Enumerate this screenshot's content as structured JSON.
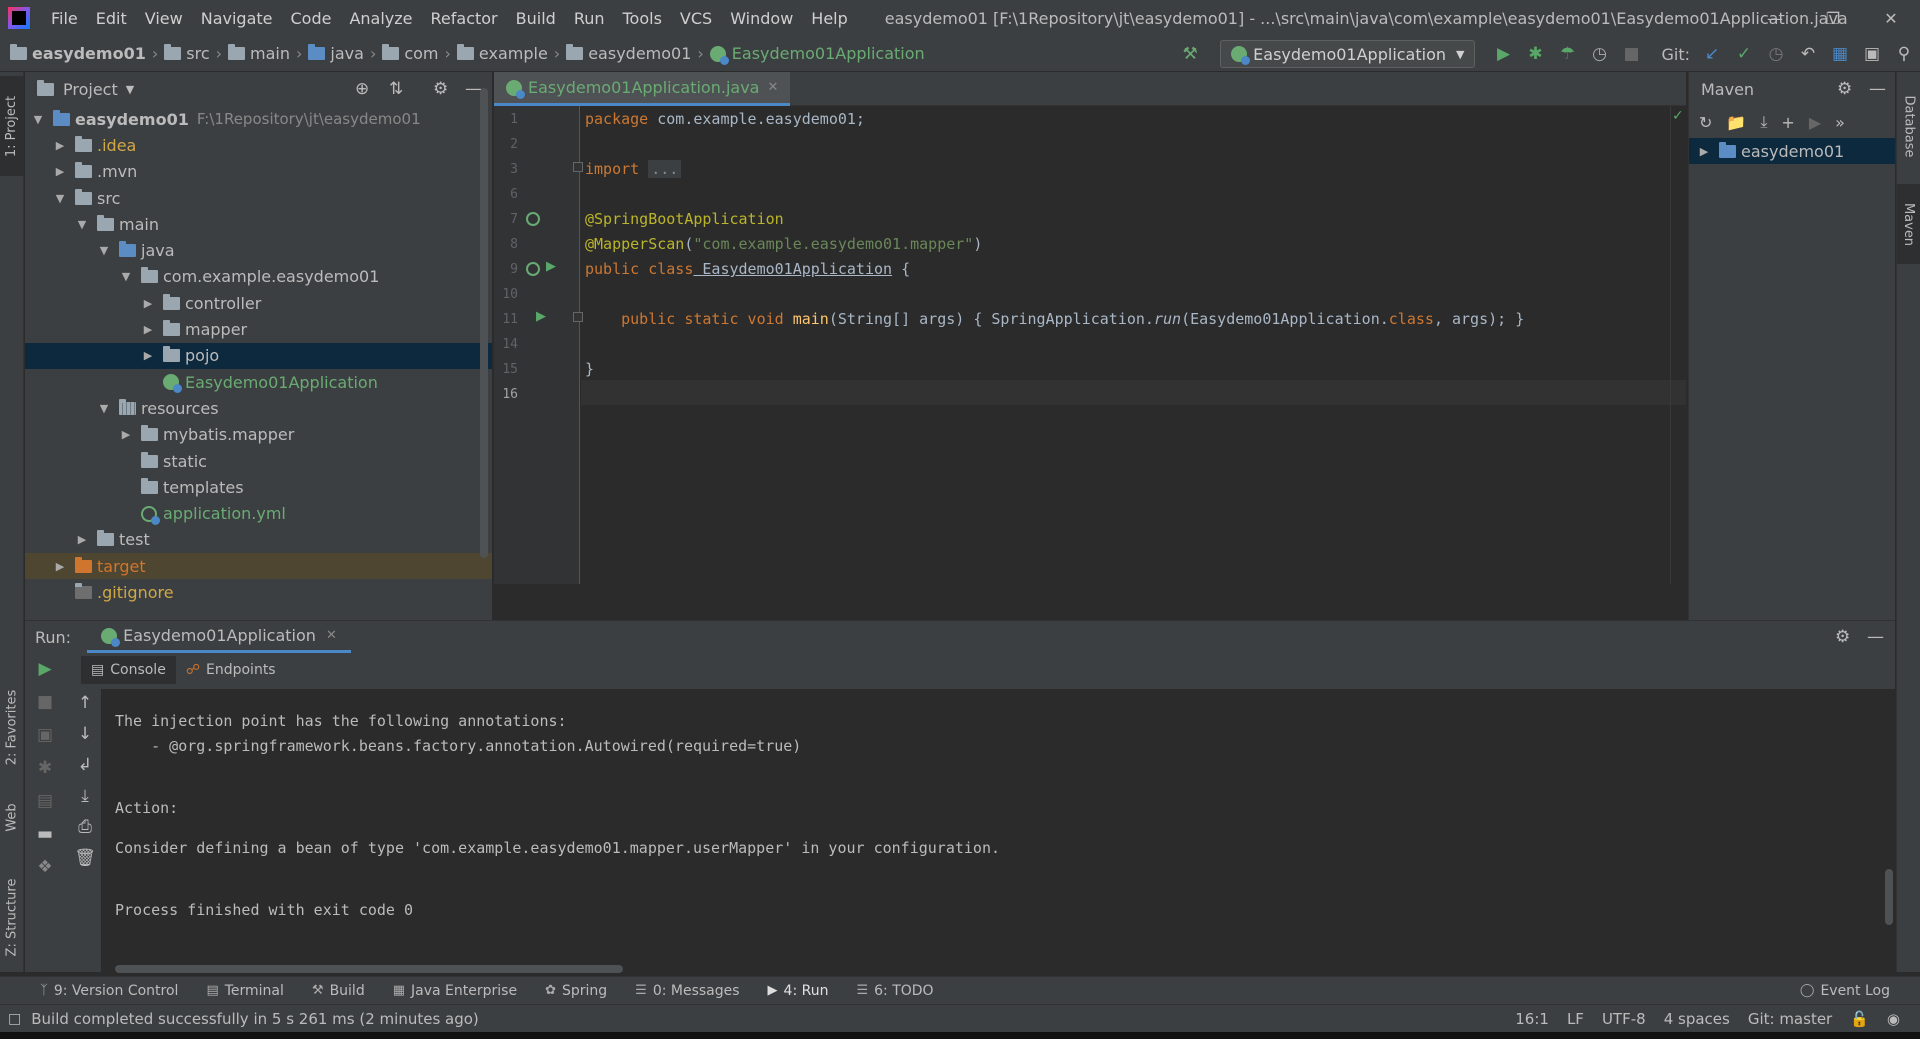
{
  "menubar": {
    "items": [
      "File",
      "Edit",
      "View",
      "Navigate",
      "Code",
      "Analyze",
      "Refactor",
      "Build",
      "Run",
      "Tools",
      "VCS",
      "Window",
      "Help"
    ],
    "window_title": "easydemo01 [F:\\1Repository\\jt\\easydemo01] - ...\\src\\main\\java\\com\\example\\easydemo01\\Easydemo01Application.java"
  },
  "breadcrumb": [
    "easydemo01",
    "src",
    "main",
    "java",
    "com",
    "example",
    "easydemo01",
    "Easydemo01Application"
  ],
  "toolbar": {
    "run_config": "Easydemo01Application",
    "git_label": "Git:"
  },
  "left_strip": {
    "project": "1: Project",
    "favorites": "2: Favorites",
    "web": "Web",
    "structure": "Z: Structure"
  },
  "right_strip": {
    "database": "Database",
    "maven": "Maven"
  },
  "project_panel": {
    "title": "Project",
    "tree": [
      {
        "label": "easydemo01",
        "path": "F:\\1Repository\\jt\\easydemo01",
        "depth": 0,
        "arrow": "down",
        "icon": "module",
        "bold": true
      },
      {
        "label": ".idea",
        "depth": 1,
        "arrow": "right",
        "icon": "folder",
        "color": "#d0a846"
      },
      {
        "label": ".mvn",
        "depth": 1,
        "arrow": "right",
        "icon": "folder"
      },
      {
        "label": "src",
        "depth": 1,
        "arrow": "down",
        "icon": "folder"
      },
      {
        "label": "main",
        "depth": 2,
        "arrow": "down",
        "icon": "folder"
      },
      {
        "label": "java",
        "depth": 3,
        "arrow": "down",
        "icon": "folder-blue"
      },
      {
        "label": "com.example.easydemo01",
        "depth": 4,
        "arrow": "down",
        "icon": "package"
      },
      {
        "label": "controller",
        "depth": 5,
        "arrow": "right",
        "icon": "package"
      },
      {
        "label": "mapper",
        "depth": 5,
        "arrow": "right",
        "icon": "package"
      },
      {
        "label": "pojo",
        "depth": 5,
        "arrow": "right",
        "icon": "package",
        "selected": true
      },
      {
        "label": "Easydemo01Application",
        "depth": 5,
        "arrow": "",
        "icon": "spring",
        "color": "#6aab73"
      },
      {
        "label": "resources",
        "depth": 3,
        "arrow": "down",
        "icon": "folder-res"
      },
      {
        "label": "mybatis.mapper",
        "depth": 4,
        "arrow": "right",
        "icon": "folder"
      },
      {
        "label": "static",
        "depth": 4,
        "arrow": "",
        "icon": "folder"
      },
      {
        "label": "templates",
        "depth": 4,
        "arrow": "",
        "icon": "folder"
      },
      {
        "label": "application.yml",
        "depth": 4,
        "arrow": "",
        "icon": "yml",
        "color": "#6aab73"
      },
      {
        "label": "test",
        "depth": 2,
        "arrow": "right",
        "icon": "folder"
      },
      {
        "label": "target",
        "depth": 1,
        "arrow": "right",
        "icon": "folder-orange",
        "color": "#d0752d",
        "excluded": true
      },
      {
        "label": ".gitignore",
        "depth": 1,
        "arrow": "",
        "icon": "file",
        "color": "#d0a846"
      }
    ]
  },
  "editor": {
    "tab_label": "Easydemo01Application.java",
    "line_numbers": [
      "1",
      "2",
      "3",
      "6",
      "7",
      "8",
      "9",
      "10",
      "11",
      "14",
      "15",
      "16"
    ],
    "lines": {
      "l1_kw": "package",
      "l1_rest": " com.example.easydemo01;",
      "l3_kw": "import",
      "l3_fold": "...",
      "l7_an": "@SpringBootApplication",
      "l8_an": "@MapperScan",
      "l8_p1": "(",
      "l8_str": "\"com.example.easydemo01.mapper\"",
      "l8_p2": ")",
      "l9_kw": "public class",
      "l9_name": " Easydemo01Application",
      "l9_rest": " {",
      "l11_kw": "    public static void",
      "l11_mth": " main",
      "l11_args": "(String[] args)",
      "l11_body1": " { SpringApplication.",
      "l11_run": "run",
      "l11_body2": "(Easydemo01Application.",
      "l11_cls": "class",
      "l11_body3": ", args); }",
      "l15": "}"
    }
  },
  "maven_panel": {
    "title": "Maven",
    "root": "easydemo01"
  },
  "run_panel": {
    "label": "Run:",
    "tab": "Easydemo01Application",
    "subtabs": [
      "Console",
      "Endpoints"
    ],
    "console": [
      "The injection point has the following annotations:",
      "    - @org.springframework.beans.factory.annotation.Autowired(required=true)",
      "Action:",
      "Consider defining a bean of type 'com.example.easydemo01.mapper.userMapper' in your configuration.",
      "Process finished with exit code 0"
    ]
  },
  "bottom_tabs": [
    "9: Version Control",
    "Terminal",
    "Build",
    "Java Enterprise",
    "Spring",
    "0: Messages",
    "4: Run",
    "6: TODO"
  ],
  "event_log": "Event Log",
  "status": {
    "message": "Build completed successfully in 5 s 261 ms (2 minutes ago)",
    "position": "16:1",
    "line_sep": "LF",
    "encoding": "UTF-8",
    "indent": "4 spaces",
    "git": "Git: master"
  },
  "colors": {
    "accent": "#4a88c7",
    "selection": "#0d293e",
    "run_green": "#59a869",
    "spring_green": "#6aab73"
  }
}
